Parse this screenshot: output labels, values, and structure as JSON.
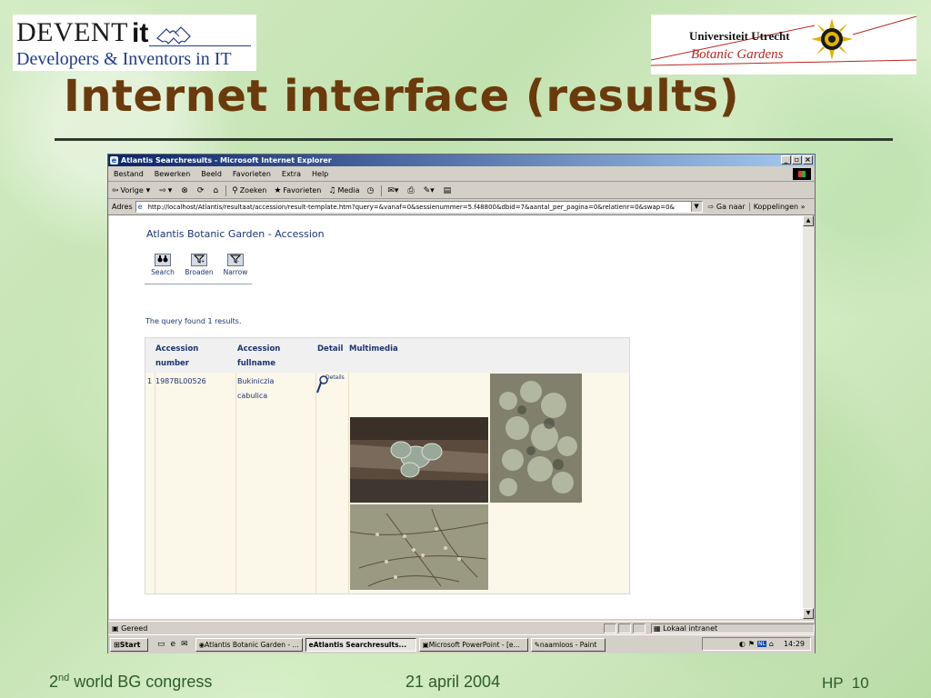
{
  "slide": {
    "title": "Internet interface (results)",
    "footer_left_ordinal": "2",
    "footer_left_sup": "nd",
    "footer_left_rest": " world BG congress",
    "footer_center": "21 april 2004",
    "footer_right": "HP  10"
  },
  "logos": {
    "devent": {
      "word": "DEVENT",
      "it": "it",
      "tagline": "Developers & Inventors in IT"
    },
    "utrecht": {
      "name": "Universiteit Utrecht",
      "subtitle": "Botanic Gardens"
    }
  },
  "browser": {
    "window_title": "Atlantis Searchresults - Microsoft Internet Explorer",
    "menu": [
      "Bestand",
      "Bewerken",
      "Beeld",
      "Favorieten",
      "Extra",
      "Help"
    ],
    "toolbar": {
      "back": "Vorige",
      "search": "Zoeken",
      "favorites": "Favorieten",
      "media": "Media"
    },
    "address_label": "Adres",
    "url": "http://localhost/Atlantis/resultaat/accession/result-template.htm?query=&vanaf=0&sessienummer=5.f48800&dbid=7&aantal_per_pagina=0&relatienr=0&swap=0&",
    "go": "Ga naar",
    "links": "Koppelingen",
    "status": "Gereed",
    "zone": "Lokaal intranet",
    "taskbar": {
      "start": "Start",
      "tasks": [
        {
          "label": "Atlantis Botanic Garden - ...",
          "active": false
        },
        {
          "label": "Atlantis Searchresults...",
          "active": true
        },
        {
          "label": "Microsoft PowerPoint - [e...",
          "active": false
        },
        {
          "label": "naamloos - Paint",
          "active": false
        }
      ],
      "clock": "14:29",
      "lang": "NL"
    }
  },
  "page": {
    "heading": "Atlantis Botanic Garden - Accession",
    "tools": [
      {
        "label": "Search",
        "icon": "binoculars-icon"
      },
      {
        "label": "Broaden",
        "icon": "funnel-plus-icon"
      },
      {
        "label": "Narrow",
        "icon": "funnel-minus-icon"
      }
    ],
    "query_found": "The query found 1 results.",
    "table": {
      "headers": {
        "accession_number_1": "Accession",
        "accession_number_2": "number",
        "accession_fullname_1": "Accession",
        "accession_fullname_2": "fullname",
        "detail": "Detail",
        "multimedia": "Multimedia"
      },
      "rows": [
        {
          "index": "1",
          "accession": "1987BL00526",
          "fullname_1": "Bukiniczia",
          "fullname_2": "cabulica",
          "details_label": "Details"
        }
      ]
    }
  }
}
